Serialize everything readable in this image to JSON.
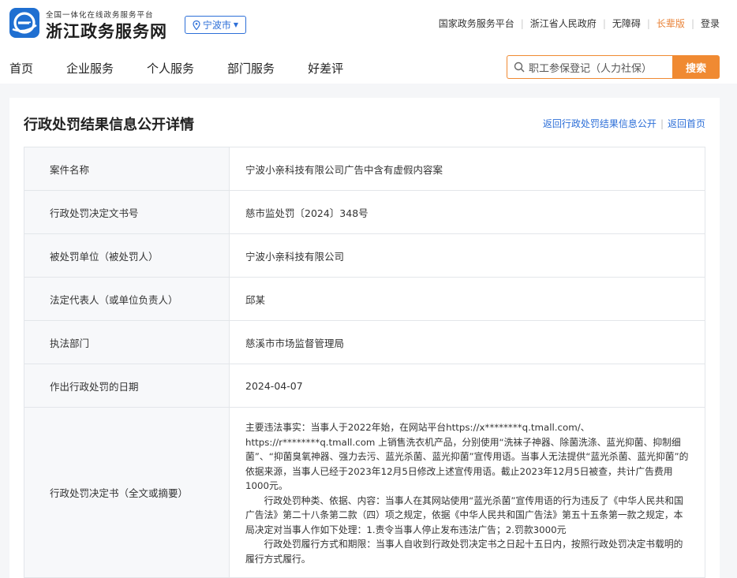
{
  "header": {
    "logo_icon": "e-logo-icon",
    "brand_small": "全国一体化在线政务服务平台",
    "brand_big": "浙江政务服务网",
    "city": "宁波市",
    "top_links": [
      "国家政务服务平台",
      "浙江省人民政府",
      "无障碍",
      "长辈版",
      "登录"
    ]
  },
  "nav": {
    "items": [
      "首页",
      "企业服务",
      "个人服务",
      "部门服务",
      "好差评"
    ]
  },
  "search": {
    "value": "职工参保登记（人力社保）",
    "button": "搜索"
  },
  "page": {
    "title": "行政处罚结果信息公开详情",
    "link_back_list": "返回行政处罚结果信息公开",
    "link_back_home": "返回首页"
  },
  "details": [
    {
      "label": "案件名称",
      "value": "宁波小亲科技有限公司广告中含有虚假内容案"
    },
    {
      "label": "行政处罚决定文书号",
      "value": "慈市监处罚〔2024〕348号"
    },
    {
      "label": "被处罚单位（被处罚人）",
      "value": "宁波小亲科技有限公司"
    },
    {
      "label": "法定代表人（或单位负责人）",
      "value": "邱某"
    },
    {
      "label": "执法部门",
      "value": "慈溪市市场监督管理局"
    },
    {
      "label": "作出行政处罚的日期",
      "value": "2024-04-07"
    }
  ],
  "decision": {
    "label": "行政处罚决定书（全文或摘要）",
    "p1": "主要违法事实：当事人于2022年始，在网站平台https://x********q.tmall.com/、https://r********q.tmall.com 上销售洗衣机产品，分别使用“洗袜子神器、除菌洗涤、蓝光抑菌、抑制细菌”、“抑菌臭氧神器、强力去污、蓝光杀菌、蓝光抑菌”宣传用语。当事人无法提供“蓝光杀菌、蓝光抑菌”的依据来源，当事人已经于2023年12月5日修改上述宣传用语。截止2023年12月5日被查，共计广告费用1000元。",
    "p2": "行政处罚种类、依据、内容：当事人在其网站使用“蓝光杀菌”宣传用语的行为违反了《中华人民共和国广告法》第二十八条第二款（四）项之规定，依据《中华人民共和国广告法》第五十五条第一款之规定，本局决定对当事人作如下处理：1.责令当事人停止发布违法广告；2.罚款3000元",
    "p3": "行政处罚履行方式和期限：当事人自收到行政处罚决定书之日起十五日内，按照行政处罚决定书载明的履行方式履行。"
  },
  "colors": {
    "brand_blue": "#1f6fd1",
    "accent_orange": "#f08a32",
    "link_blue": "#2d6fd8"
  }
}
